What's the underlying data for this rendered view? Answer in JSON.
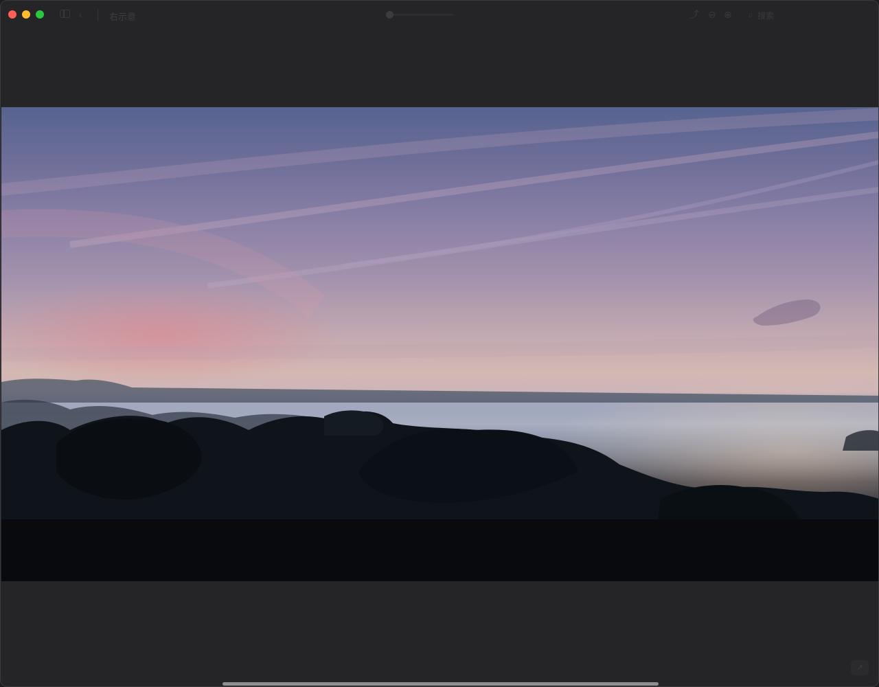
{
  "window": {
    "title": "右示意",
    "search_label": "搜索"
  },
  "toolbar": {
    "back_icon": "chevron-left-icon",
    "forward_icon": "chevron-right-icon",
    "share_icon": "share-icon",
    "zoom_out_icon": "zoom-out-icon",
    "zoom_in_icon": "zoom-in-icon",
    "search_icon": "search-icon"
  },
  "playback": {
    "progress": 0.02
  },
  "video": {
    "description_icon": "video-frame"
  },
  "colors": {
    "close": "#ff5f57",
    "minimize": "#febc2e",
    "zoom": "#28c840",
    "window_bg": "#252527"
  }
}
